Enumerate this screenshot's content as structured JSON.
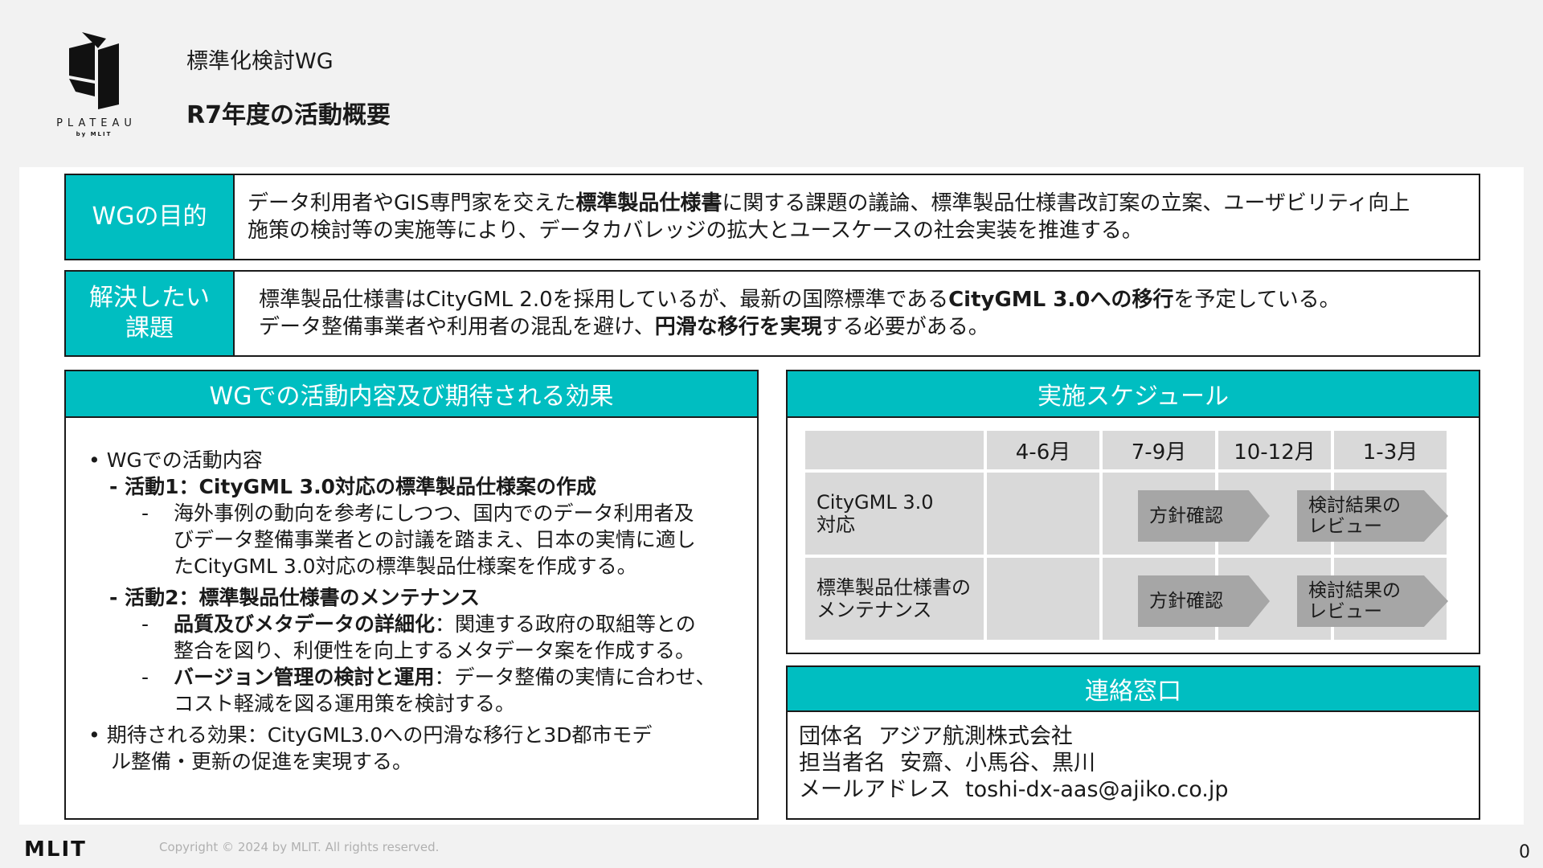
{
  "header": {
    "logo_text": "PLATEAU",
    "logo_sub": "by MLIT",
    "wg_name": "標準化検討WG",
    "page_title": "R7年度の活動概要"
  },
  "purpose": {
    "label": "WGの目的",
    "line1_pre": "データ利用者やGIS専門家を交えた",
    "line1_bold": "標準製品仕様書",
    "line1_post": "に関する課題の議論、標準製品仕様書改訂案の立案、ユーザビリティ向上",
    "line2": "施策の検討等の実施等により、データカバレッジの拡大とユースケースの社会実装を推進する。"
  },
  "issue": {
    "label": "解決したい\n課題",
    "line1_pre": "標準製品仕様書はCityGML 2.0を採用しているが、最新の国際標準である",
    "line1_bold": "CityGML 3.0への移行",
    "line1_post": "を予定している。",
    "line2_pre": "データ整備事業者や利用者の混乱を避け、",
    "line2_bold": "円滑な移行を実現",
    "line2_post": "する必要がある。"
  },
  "activities": {
    "heading": "WGでの活動内容及び期待される効果",
    "bullet1": "• WGでの活動内容",
    "act1_title": "- 活動1：CityGML 3.0対応の標準製品仕様案の作成",
    "act1_l1": "海外事例の動向を参考にしつつ、国内でのデータ利用者及",
    "act1_l2": "びデータ整備事業者との討議を踏まえ、日本の実情に適し",
    "act1_l3": "たCityGML 3.0対応の標準製品仕様案を作成する。",
    "act2_title": "- 活動2：標準製品仕様書のメンテナンス",
    "act2a_bold": "品質及びメタデータの詳細化",
    "act2a_rest": "：関連する政府の取組等との",
    "act2a_l2": "整合を図り、利便性を向上するメタデータ案を作成する。",
    "act2b_bold": "バージョン管理の検討と運用",
    "act2b_rest": "：データ整備の実情に合わせ、",
    "act2b_l2": "コスト軽減を図る運用策を検討する。",
    "effect_l1": "• 期待される効果：CityGML3.0への円滑な移行と3D都市モデ",
    "effect_l2": "ル整備・更新の促進を実現する。",
    "dash": "-"
  },
  "schedule": {
    "heading": "実施スケジュール",
    "columns": [
      "4-6月",
      "7-9月",
      "10-12月",
      "1-3月"
    ],
    "rows": [
      {
        "label_l1": "CityGML 3.0",
        "label_l2": "対応",
        "arrow1": "方針確認",
        "arrow2_l1": "検討結果の",
        "arrow2_l2": "レビュー"
      },
      {
        "label_l1": "標準製品仕様書の",
        "label_l2": "メンテナンス",
        "arrow1": "方針確認",
        "arrow2_l1": "検討結果の",
        "arrow2_l2": "レビュー"
      }
    ]
  },
  "contact": {
    "heading": "連絡窓口",
    "org_key": "団体名",
    "org_val": "アジア航測株式会社",
    "person_key": "担当者名",
    "person_val": "安齋、小馬谷、黒川",
    "mail_key": "メールアドレス",
    "mail_val": "toshi-dx-aas@ajiko.co.jp"
  },
  "footer": {
    "brand": "MLIT",
    "copyright": "Copyright © 2024 by MLIT. All rights reserved.",
    "page_number": "0"
  },
  "colors": {
    "accent": "#00bec1",
    "cell_gray": "#d9d9d9",
    "arrow_gray": "#a6a6a6"
  }
}
